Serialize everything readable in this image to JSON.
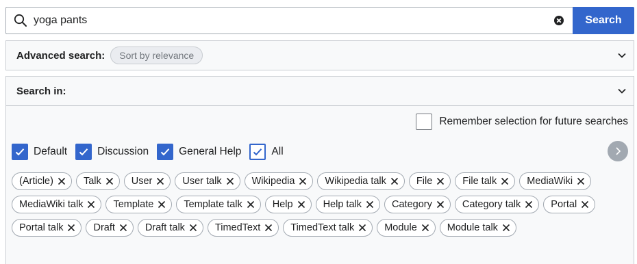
{
  "search": {
    "value": "yoga pants",
    "button_label": "Search"
  },
  "advanced": {
    "title": "Advanced search:",
    "sort_label": "Sort by relevance"
  },
  "search_in": {
    "title": "Search in:"
  },
  "remember": {
    "label": "Remember selection for future searches",
    "checked": false
  },
  "presets": [
    {
      "label": "Default",
      "checked": true
    },
    {
      "label": "Discussion",
      "checked": true
    },
    {
      "label": "General Help",
      "checked": true
    },
    {
      "label": "All",
      "checked": true
    }
  ],
  "namespaces": [
    "(Article)",
    "Talk",
    "User",
    "User talk",
    "Wikipedia",
    "Wikipedia talk",
    "File",
    "File talk",
    "MediaWiki",
    "MediaWiki talk",
    "Template",
    "Template talk",
    "Help",
    "Help talk",
    "Category",
    "Category talk",
    "Portal",
    "Portal talk",
    "Draft",
    "Draft talk",
    "TimedText",
    "TimedText talk",
    "Module",
    "Module talk"
  ],
  "colors": {
    "accent": "#3366cc",
    "panel_bg": "#f8f9fa",
    "border": "#c8ccd1"
  }
}
